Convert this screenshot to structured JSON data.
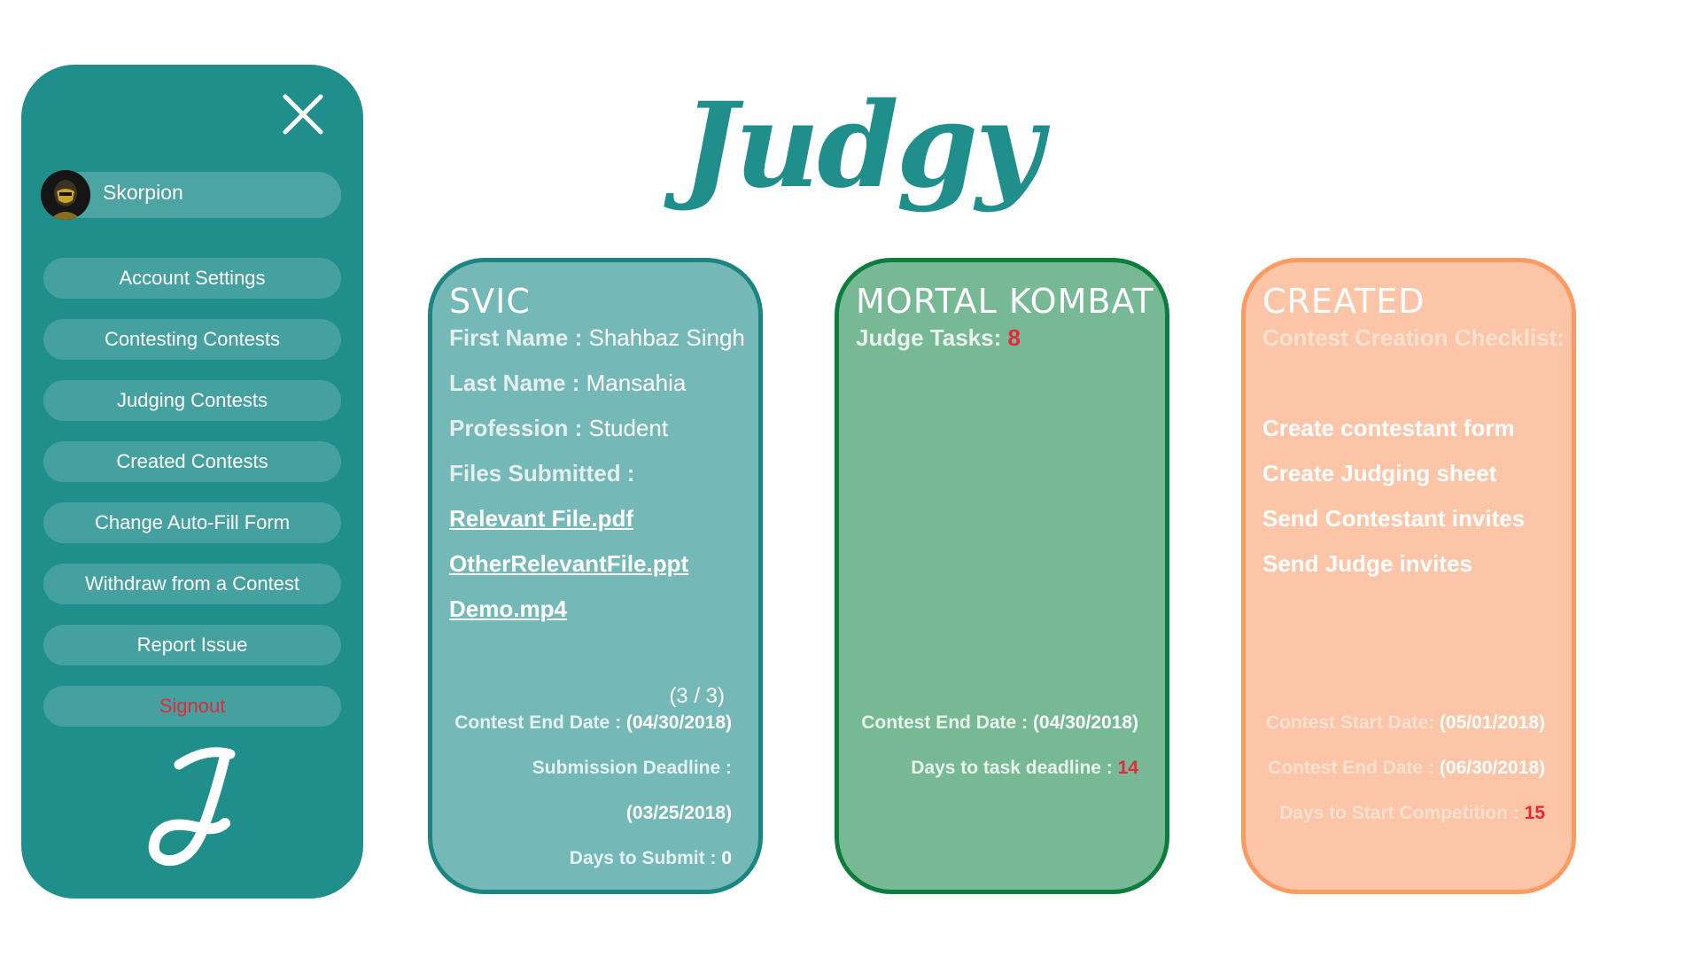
{
  "sidebar": {
    "profile": {
      "name": "Skorpion"
    },
    "items": [
      {
        "label": "Account Settings"
      },
      {
        "label": "Contesting Contests"
      },
      {
        "label": "Judging Contests"
      },
      {
        "label": "Created Contests"
      },
      {
        "label": "Change Auto-Fill Form"
      },
      {
        "label": "Withdraw from a Contest"
      },
      {
        "label": "Report Issue"
      },
      {
        "label": "Signout"
      }
    ]
  },
  "brand": {
    "title": "Judgy"
  },
  "cards": {
    "svic": {
      "title": "SVIC",
      "first_name_label": "First Name :",
      "first_name": "Shahbaz Singh",
      "last_name_label": "Last Name :",
      "last_name": "Mansahia",
      "profession_label": "Profession :",
      "profession": "Student",
      "files_label": "Files Submitted :",
      "files": [
        "Relevant File.pdf",
        "OtherRelevantFile.ppt",
        "Demo.mp4"
      ],
      "file_count": "(3 / 3)",
      "end_date_label": "Contest End Date :",
      "end_date": "(04/30/2018)",
      "deadline_label": "Submission Deadline :",
      "deadline": "(03/25/2018)",
      "days_label": "Days to Submit :",
      "days": "0"
    },
    "mortal_kombat": {
      "title": "MORTAL KOMBAT",
      "tasks_label": "Judge Tasks:",
      "tasks_count": "8",
      "end_date_label": "Contest End Date :",
      "end_date": "(04/30/2018)",
      "days_label": "Days to task deadline :",
      "days": "14"
    },
    "created": {
      "title": "CREATED",
      "checklist_label": "Contest Creation Checklist:",
      "checklist": [
        "Create contestant form",
        "Create Judging sheet",
        "Send Contestant invites",
        "Send Judge invites"
      ],
      "start_date_label": "Contest Start Date:",
      "start_date": "(05/01/2018)",
      "end_date_label": "Contest End Date :",
      "end_date": "(06/30/2018)",
      "days_label": "Days to Start Competition :",
      "days": "15"
    }
  },
  "colors": {
    "teal": "#208f8c",
    "card_blue": "#74b9b7",
    "card_green": "#77b994",
    "card_orange": "#fdc5a8",
    "alert_red": "#e5283c"
  }
}
